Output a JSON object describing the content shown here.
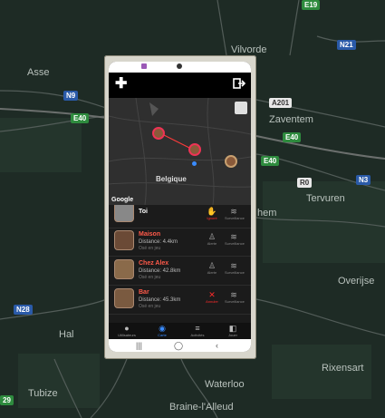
{
  "background_map": {
    "labels": [
      "Asse",
      "Vilvorde",
      "Zaventem",
      "Tervuren",
      "Overijse",
      "Hal",
      "Waterloo",
      "Rixensart",
      "Tubize",
      "Braine-l'Alleud",
      "hem"
    ],
    "shields": [
      "E19",
      "N21",
      "A201",
      "E40",
      "R0",
      "N3",
      "N9",
      "E40",
      "N28",
      "29",
      "E40"
    ]
  },
  "app": {
    "map_label": "Belgique",
    "map_attribution": "Google",
    "accent": "#ff3b3b",
    "rows": [
      {
        "title": "Toi",
        "title_color": "#ffffff",
        "sub": "",
        "sub2": "",
        "act1_icon": "✋",
        "act1_label": "Ignoré",
        "act1_color": "#ff2b2b",
        "act2_icon": "≋",
        "act2_label": "Surveillance"
      },
      {
        "title": "Maison",
        "title_color": "#ff5a4a",
        "sub": "Distance: 4.4km",
        "sub2": "Osé en jeu",
        "act1_icon": "♙",
        "act1_label": "Alerte",
        "act1_color": "#aaaaaa",
        "act2_icon": "≋",
        "act2_label": "Surveillance"
      },
      {
        "title": "Chez Alex",
        "title_color": "#ff5a4a",
        "sub": "Distance: 42.8km",
        "sub2": "Osé en jeu",
        "act1_icon": "♙",
        "act1_label": "Alerte",
        "act1_color": "#aaaaaa",
        "act2_icon": "≋",
        "act2_label": "Surveillance"
      },
      {
        "title": "Bar",
        "title_color": "#ff5a4a",
        "sub": "Distance: 45.3km",
        "sub2": "Osé en jeu",
        "act1_icon": "✕",
        "act1_label": "Annuler",
        "act1_color": "#ff2b2b",
        "act2_icon": "≋",
        "act2_label": "Surveillance"
      }
    ],
    "nav": [
      {
        "icon": "●",
        "label": "Utilisateurs"
      },
      {
        "icon": "◉",
        "label": "Carte"
      },
      {
        "icon": "≡",
        "label": "Activités"
      },
      {
        "icon": "◧",
        "label": "Jouer"
      }
    ],
    "system_buttons": [
      "|||",
      "◯",
      "‹"
    ]
  }
}
